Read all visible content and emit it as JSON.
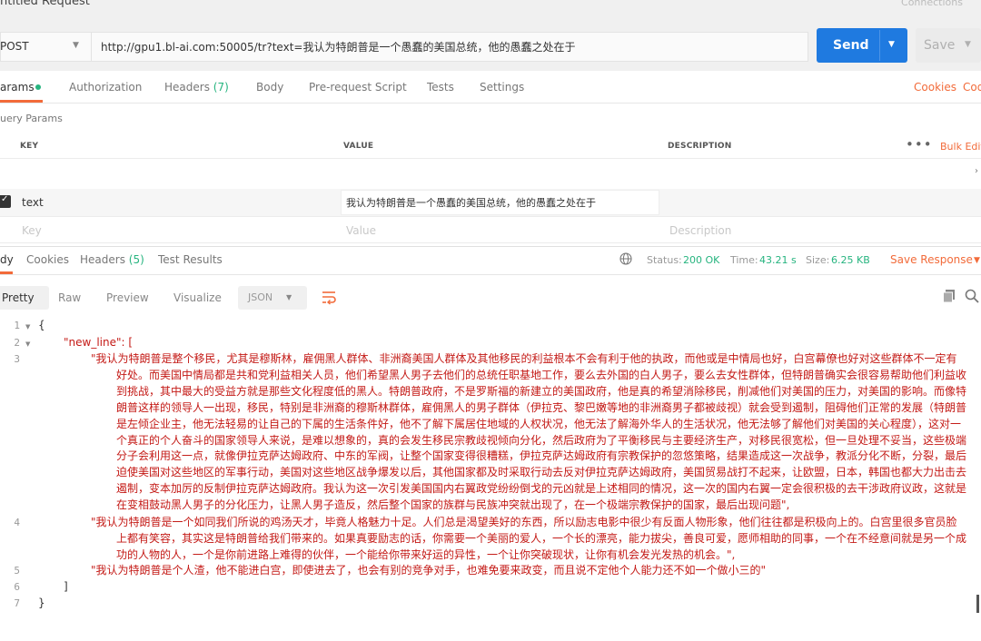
{
  "window": {
    "title": "ntitled Request",
    "right_label": "Connections"
  },
  "request": {
    "method": "POST",
    "url": "http://gpu1.bl-ai.com:50005/tr?text=我认为特朗普是一个愚蠢的美国总统，他的愚蠢之处在于",
    "send_label": "Send",
    "save_label": "Save"
  },
  "request_tabs": {
    "params": "arams",
    "authorization": "Authorization",
    "headers": "Headers",
    "headers_count": "(7)",
    "body": "Body",
    "pre_request": "Pre-request Script",
    "tests": "Tests",
    "settings": "Settings",
    "cookies": "Cookies",
    "code": "Code"
  },
  "query_params": {
    "label": "uery Params",
    "col_key": "KEY",
    "col_value": "VALUE",
    "col_description": "DESCRIPTION",
    "bulk_edit": "Bulk Edit",
    "rows": [
      {
        "checked": true,
        "key": "text",
        "value": "我认为特朗普是一个愚蠢的美国总统，他的愚蠢之处在于"
      }
    ],
    "placeholder_key": "Key",
    "placeholder_value": "Value",
    "placeholder_description": "Description"
  },
  "response_tabs": {
    "body": "dy",
    "cookies": "Cookies",
    "headers": "Headers",
    "headers_count": "(5)",
    "test_results": "Test Results"
  },
  "response_meta": {
    "status_label": "Status:",
    "status_value": "200 OK",
    "time_label": "Time:",
    "time_value": "43.21 s",
    "size_label": "Size:",
    "size_value": "6.25 KB",
    "save_response": "Save Response"
  },
  "view_modes": {
    "pretty": "Pretty",
    "raw": "Raw",
    "preview": "Preview",
    "visualize": "Visualize",
    "format": "JSON"
  },
  "code": {
    "line_numbers": [
      "1",
      "2",
      "3",
      "4",
      "5",
      "6",
      "7"
    ],
    "open_brace": "{",
    "key_line": "\"new_line\": [",
    "item1": "\"我认为特朗普是整个移民，尤其是穆斯林，雇佣黑人群体、非洲裔美国人群体及其他移民的利益根本不会有利于他的执政，而他或是中情局也好，白宫幕僚也好对这些群体不一定有好处。而美国中情局都是共和党利益相关人员，他们希望黑人男子去他们的总统任职基地工作，要么去外国的白人男子，要么去女性群体，但特朗普确实会很容易帮助他们利益收到挑战，其中最大的受益方就是那些文化程度低的黑人。特朗普政府，不是罗斯福的新建立的美国政府，他是真的希望消除移民，削减他们对美国的压力，对美国的影响。而像特朗普这样的领导人一出现，移民，特别是非洲裔的穆斯林群体，雇佣黑人的男子群体（伊拉克、黎巴嫩等地的非洲裔男子都被歧视）就会受到遏制，阻碍他们正常的发展（特朗普是左倾企业主，他无法轻易的让自己的下属的生活条件好，他不了解下属居住地域的人权状况，他无法了解海外华人的生活状况，他无法够了解他们对美国的关心程度），这对一个真正的个人奋斗的国家领导人来说，是难以想象的，真的会发生移民宗教歧视倾向分化，然后政府为了平衡移民与主要经济生产，对移民很宽松，但一旦处理不妥当，这些极端分子会利用这一点，就像伊拉克萨达姆政府、中东的军阀，让整个国家变得很糟糕，伊拉克萨达姆政府有宗教保护的忽悠策略，结果造成这一次战争，教派分化不断，分裂，最后迫使美国对这些地区的军事行动，美国对这些地区战争爆发以后，其他国家都及时采取行动去反对伊拉克萨达姆政府，美国贸易战打不起来，让欧盟，日本，韩国也都大力出击去遏制，变本加厉的反制伊拉克萨达姆政府。我认为这一次引发美国国内右翼政党纷纷倒戈的元凶就是上述相同的情况，这一次的国内右翼一定会很积极的去干涉政府议政，这就是在变相鼓动黑人男子的分化压力，让黑人男子造反，然后整个国家的族群与民族冲突就出现了，在一个极端宗教保护的国家，最后出现问题\",",
    "item2": "\"我认为特朗普是一个如同我们所说的鸡汤天才，毕竟人格魅力十足。人们总是渴望美好的东西，所以励志电影中很少有反面人物形象，他们往往都是积极向上的。白宫里很多官员脸上都有笑容，其实这是特朗普给我们带来的。如果真要励志的话，你需要一个美丽的爱人，一个长的漂亮，能力拔尖，善良可爱，愿师相助的同事，一个在不经意间就是另一个成功的人物的人，一个是你前进路上难得的伙伴，一个能给你带来好运的异性，一个让你突破现状，让你有机会发光发热的机会。\",",
    "item3": "\"我认为特朗普是个人渣，他不能进白宫，即使进去了，也会有别的竞争对手，也难免要来政变，而且说不定他个人能力还不如一个做小三的\"",
    "close_bracket": "]",
    "close_brace": "}"
  },
  "colors": {
    "accent_orange": "#f26b3a",
    "send_blue": "#1f7ae0",
    "status_green": "#26b47f",
    "string_red": "#c41a16"
  },
  "icons": [
    "chevron-down-icon",
    "more-horizontal-icon",
    "check-icon",
    "globe-icon",
    "wrap-lines-icon",
    "copy-icon",
    "search-icon",
    "fold-arrow-icon"
  ]
}
